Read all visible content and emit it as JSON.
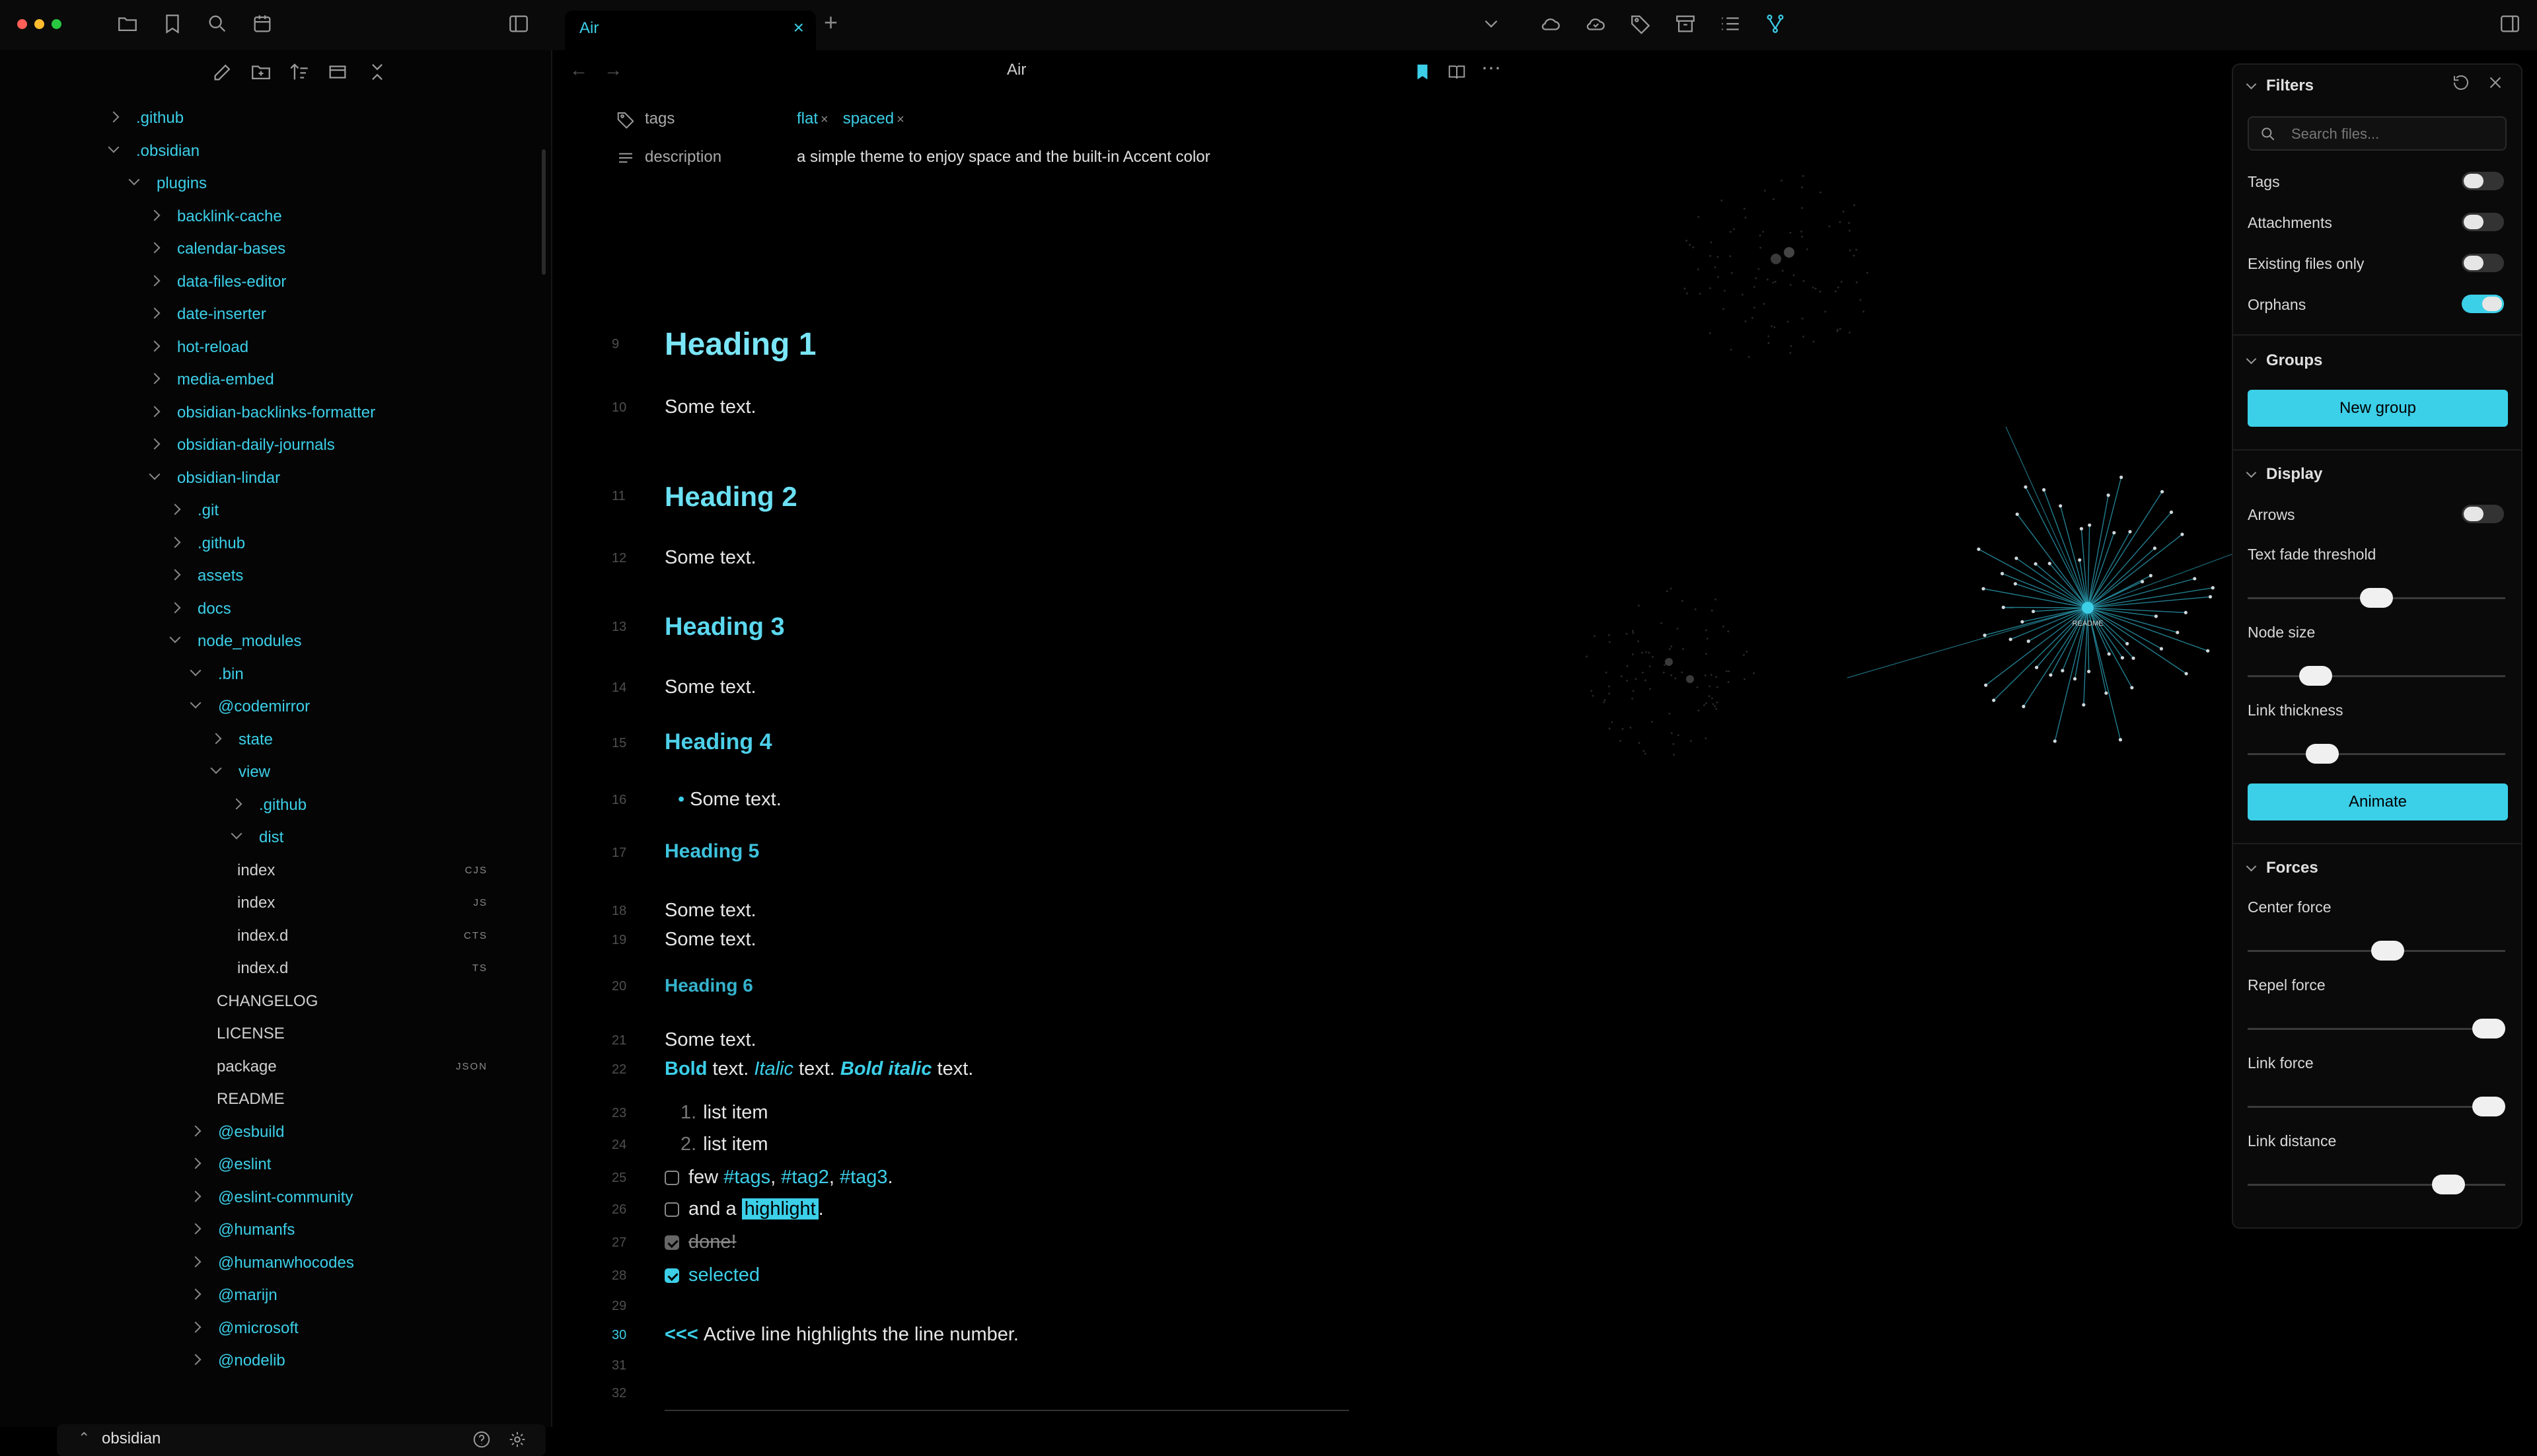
{
  "tabs": [
    {
      "label": "Air"
    }
  ],
  "sidebar": {
    "tree": [
      {
        "label": ".github",
        "indent": 0,
        "state": "closed"
      },
      {
        "label": ".obsidian",
        "indent": 0,
        "state": "open"
      },
      {
        "label": "plugins",
        "indent": 1,
        "state": "open"
      },
      {
        "label": "backlink-cache",
        "indent": 2,
        "state": "closed"
      },
      {
        "label": "calendar-bases",
        "indent": 2,
        "state": "closed"
      },
      {
        "label": "data-files-editor",
        "indent": 2,
        "state": "closed"
      },
      {
        "label": "date-inserter",
        "indent": 2,
        "state": "closed"
      },
      {
        "label": "hot-reload",
        "indent": 2,
        "state": "closed"
      },
      {
        "label": "media-embed",
        "indent": 2,
        "state": "closed"
      },
      {
        "label": "obsidian-backlinks-formatter",
        "indent": 2,
        "state": "closed"
      },
      {
        "label": "obsidian-daily-journals",
        "indent": 2,
        "state": "closed"
      },
      {
        "label": "obsidian-lindar",
        "indent": 2,
        "state": "open"
      },
      {
        "label": ".git",
        "indent": 3,
        "state": "closed"
      },
      {
        "label": ".github",
        "indent": 3,
        "state": "closed"
      },
      {
        "label": "assets",
        "indent": 3,
        "state": "closed"
      },
      {
        "label": "docs",
        "indent": 3,
        "state": "closed"
      },
      {
        "label": "node_modules",
        "indent": 3,
        "state": "open"
      },
      {
        "label": ".bin",
        "indent": 4,
        "state": "open"
      },
      {
        "label": "@codemirror",
        "indent": 4,
        "state": "open"
      },
      {
        "label": "state",
        "indent": 5,
        "state": "closed"
      },
      {
        "label": "view",
        "indent": 5,
        "state": "open"
      },
      {
        "label": ".github",
        "indent": 6,
        "state": "closed"
      },
      {
        "label": "dist",
        "indent": 6,
        "state": "open"
      },
      {
        "label": "index",
        "indent": 7,
        "state": "file",
        "ext": "CJS"
      },
      {
        "label": "index",
        "indent": 7,
        "state": "file",
        "ext": "JS"
      },
      {
        "label": "index.d",
        "indent": 7,
        "state": "file",
        "ext": "CTS"
      },
      {
        "label": "index.d",
        "indent": 7,
        "state": "file",
        "ext": "TS"
      },
      {
        "label": "CHANGELOG",
        "indent": 6,
        "state": "file",
        "ext": ""
      },
      {
        "label": "LICENSE",
        "indent": 6,
        "state": "file",
        "ext": ""
      },
      {
        "label": "package",
        "indent": 6,
        "state": "file",
        "ext": "JSON"
      },
      {
        "label": "README",
        "indent": 6,
        "state": "file",
        "ext": ""
      },
      {
        "label": "@esbuild",
        "indent": 4,
        "state": "closed"
      },
      {
        "label": "@eslint",
        "indent": 4,
        "state": "closed"
      },
      {
        "label": "@eslint-community",
        "indent": 4,
        "state": "closed"
      },
      {
        "label": "@humanfs",
        "indent": 4,
        "state": "closed"
      },
      {
        "label": "@humanwhocodes",
        "indent": 4,
        "state": "closed"
      },
      {
        "label": "@marijn",
        "indent": 4,
        "state": "closed"
      },
      {
        "label": "@microsoft",
        "indent": 4,
        "state": "closed"
      },
      {
        "label": "@nodelib",
        "indent": 4,
        "state": "closed"
      }
    ],
    "vault_name": "obsidian"
  },
  "editor": {
    "view_title": "Air",
    "properties": {
      "tags_key": "tags",
      "tags": [
        "flat",
        "spaced"
      ],
      "description_key": "description",
      "description_value": "a simple theme to enjoy space and the built-in Accent color"
    },
    "lines": {
      "l9": {
        "num": "9",
        "text": "Heading 1"
      },
      "l10": {
        "num": "10",
        "text": "Some text."
      },
      "l11": {
        "num": "11",
        "text": "Heading 2"
      },
      "l12": {
        "num": "12",
        "text": "Some text."
      },
      "l13": {
        "num": "13",
        "text": "Heading 3"
      },
      "l14": {
        "num": "14",
        "text": "Some text."
      },
      "l15": {
        "num": "15",
        "text": "Heading 4"
      },
      "l16": {
        "num": "16",
        "text": "Some text."
      },
      "l17": {
        "num": "17",
        "text": "Heading 5"
      },
      "l18": {
        "num": "18",
        "text": "Some text."
      },
      "l19": {
        "num": "19",
        "text": "Some text."
      },
      "l20": {
        "num": "20",
        "text": "Heading 6"
      },
      "l21": {
        "num": "21",
        "text": "Some text."
      },
      "l22": {
        "num": "22",
        "bold": "Bold",
        "t1": " text. ",
        "italic": "Italic",
        "t2": " text. ",
        "bolditalic": "Bold italic",
        "t3": " text."
      },
      "l23": {
        "num": "23",
        "marker": "1.",
        "text": "list item"
      },
      "l24": {
        "num": "24",
        "marker": "2.",
        "text": "list item"
      },
      "l25": {
        "num": "25",
        "text_pre": "few ",
        "tag1": "#tags",
        "sep1": ", ",
        "tag2": "#tag2",
        "sep2": ", ",
        "tag3": "#tag3",
        "end": "."
      },
      "l26": {
        "num": "26",
        "text_pre": "and a ",
        "highlight": "highlight",
        "end": "."
      },
      "l27": {
        "num": "27",
        "text": "done!"
      },
      "l28": {
        "num": "28",
        "text": "selected"
      },
      "l29": {
        "num": "29"
      },
      "l30": {
        "num": "30",
        "marker": "<<<",
        "text": "Active line highlights the line number."
      },
      "l31": {
        "num": "31"
      },
      "l32": {
        "num": "32"
      }
    }
  },
  "graph_controls": {
    "filters_title": "Filters",
    "search_placeholder": "Search files...",
    "tags_label": "Tags",
    "attachments_label": "Attachments",
    "existing_label": "Existing files only",
    "orphans_label": "Orphans",
    "groups_title": "Groups",
    "new_group_label": "New group",
    "display_title": "Display",
    "arrows_label": "Arrows",
    "text_fade_label": "Text fade threshold",
    "node_size_label": "Node size",
    "link_thickness_label": "Link thickness",
    "animate_label": "Animate",
    "forces_title": "Forces",
    "center_force_label": "Center force",
    "repel_force_label": "Repel force",
    "link_force_label": "Link force",
    "link_distance_label": "Link distance",
    "toggles": {
      "tags": false,
      "attachments": false,
      "existing": false,
      "orphans": true,
      "arrows": false
    },
    "slider_levels": {
      "text_fade": 0.5,
      "node_size": 0.23,
      "link_thickness": 0.26,
      "center_force": 0.55,
      "repel_force": 1.0,
      "link_force": 1.0,
      "link_distance": 0.82
    }
  },
  "graph": {
    "center_label": "README"
  },
  "colors": {
    "accent": "#3ccfe8",
    "background": "#000000"
  }
}
